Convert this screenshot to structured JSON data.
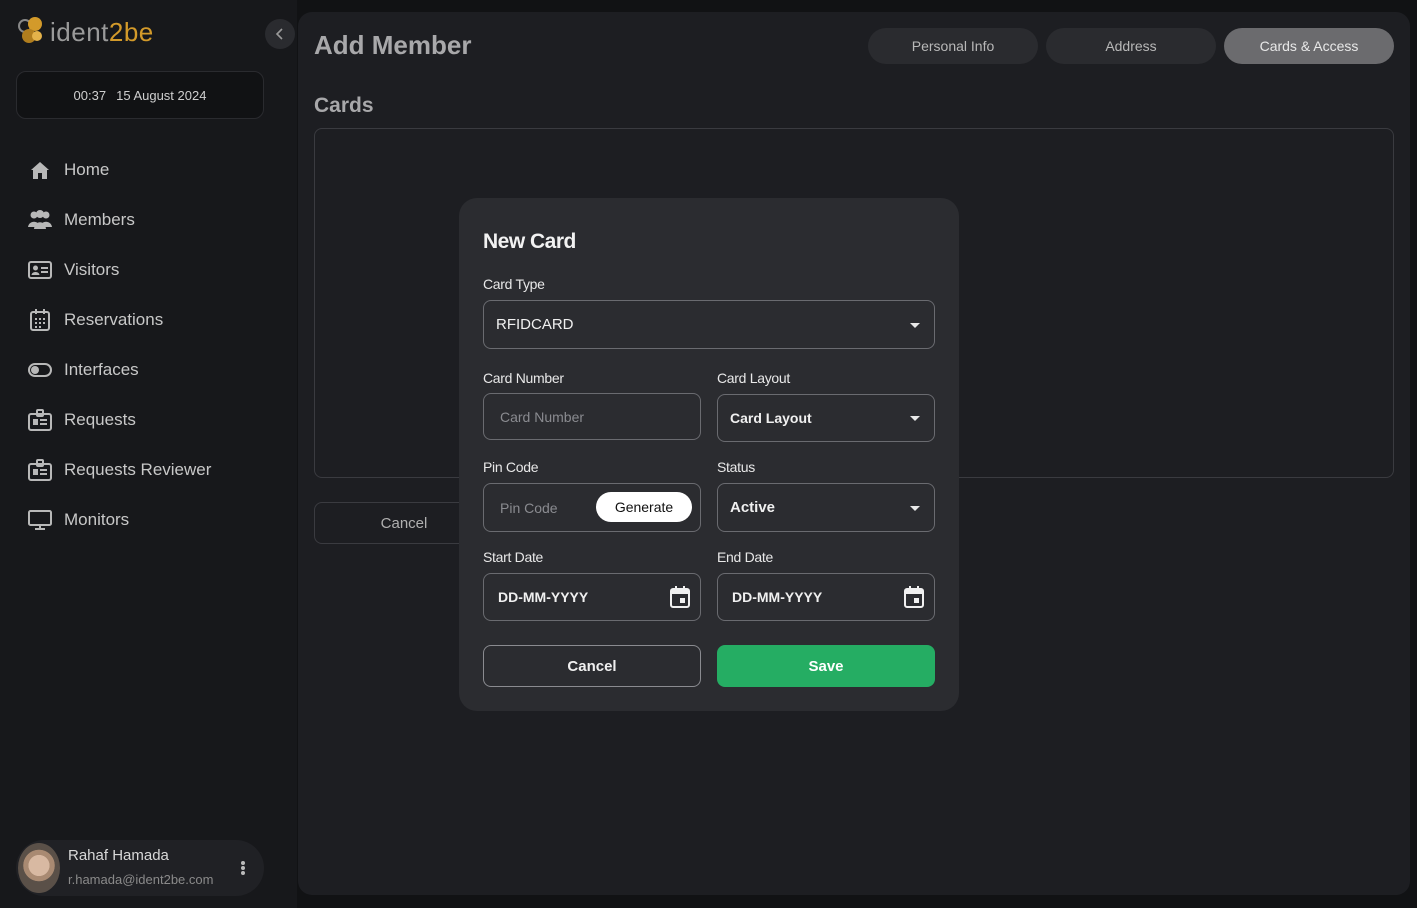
{
  "app": {
    "logo_text_main": "ident",
    "logo_text_accent": "2be"
  },
  "clock": {
    "time": "00:37",
    "date": "15 August 2024"
  },
  "sidebar": {
    "items": [
      {
        "label": "Home",
        "icon": "home-icon"
      },
      {
        "label": "Members",
        "icon": "members-icon"
      },
      {
        "label": "Visitors",
        "icon": "id-card-icon"
      },
      {
        "label": "Reservations",
        "icon": "calendar-icon"
      },
      {
        "label": "Interfaces",
        "icon": "toggle-icon"
      },
      {
        "label": "Requests",
        "icon": "badge-icon"
      },
      {
        "label": "Requests Reviewer",
        "icon": "badge-icon"
      },
      {
        "label": "Monitors",
        "icon": "monitor-icon"
      }
    ]
  },
  "user": {
    "name": "Rahaf Hamada",
    "email": "r.hamada@ident2be.com"
  },
  "main": {
    "title": "Add Member",
    "tabs": [
      {
        "label": "Personal Info",
        "active": false
      },
      {
        "label": "Address",
        "active": false
      },
      {
        "label": "Cards & Access",
        "active": true
      }
    ],
    "section_title": "Cards",
    "cancel_label": "Cancel"
  },
  "modal": {
    "title": "New Card",
    "card_type": {
      "label": "Card Type",
      "value": "RFIDCARD"
    },
    "card_number": {
      "label": "Card Number",
      "placeholder": "Card Number"
    },
    "card_layout": {
      "label": "Card Layout",
      "value": "Card Layout"
    },
    "pin_code": {
      "label": "Pin Code",
      "placeholder": "Pin Code",
      "generate_label": "Generate"
    },
    "status": {
      "label": "Status",
      "value": "Active"
    },
    "start_date": {
      "label": "Start Date",
      "value": "DD-MM-YYYY"
    },
    "end_date": {
      "label": "End Date",
      "value": "DD-MM-YYYY"
    },
    "cancel_label": "Cancel",
    "save_label": "Save"
  },
  "colors": {
    "accent_save": "#25ad63",
    "logo_accent": "#d39a2a"
  }
}
